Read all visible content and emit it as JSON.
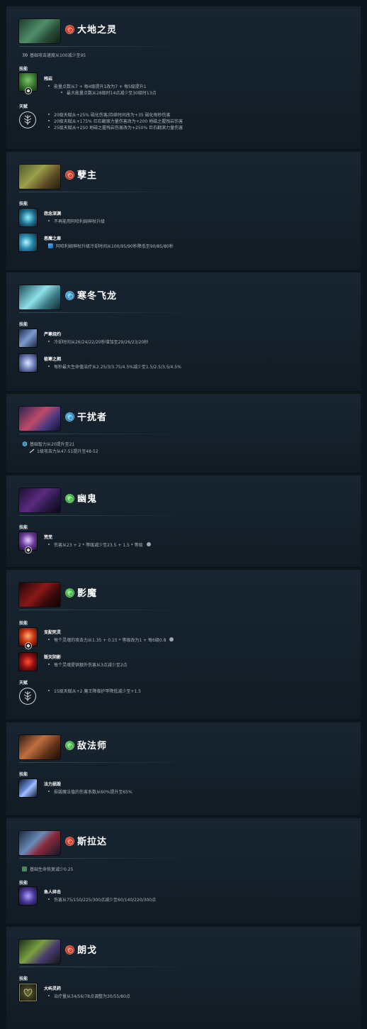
{
  "labels": {
    "abilities": "技能",
    "talents": "天赋"
  },
  "heroes": [
    {
      "name": "大地之灵",
      "attribute": "strength",
      "general": [
        "基础攻击速度从100减少至95"
      ],
      "abilities": [
        {
          "name": "残岩",
          "notes": [
            "能量点数从7 + 每4级提升1改为7 + 每5级提升1",
            "最大能量点数从28级时14点减少至30级时13点"
          ]
        }
      ],
      "talents": [
        "20级天赋从+25% 磁化伤害/持续时间改为+35 磁化每秒伤害",
        "20级天赋从+175% 巨石翻滚力量伤害改为+200 地磁之握残岩伤害",
        "25级天赋从+250 地磁之握残岩伤害改为+250% 巨石翻滚力量伤害"
      ]
    },
    {
      "name": "孽主",
      "attribute": "strength",
      "abilities": [
        {
          "name": "怨念深渊",
          "notes": [
            "不再能用阿哈利姆神杖升级"
          ]
        },
        {
          "name": "恶魔之扉",
          "notes": [
            "阿哈利姆神杖升级冷却时间从100/95/90秒降低至90/85/80秒"
          ]
        }
      ]
    },
    {
      "name": "寒冬飞龙",
      "attribute": "intelligence",
      "abilities": [
        {
          "name": "严寒烧灼",
          "notes": [
            "冷却时间从26/24/22/20秒增加至29/26/23/20秒"
          ]
        },
        {
          "name": "极寒之拥",
          "notes": [
            "每秒最大生命值治疗从2.25/3/3.75/4.5%减少至1.5/2.5/3.5/4.5%"
          ]
        }
      ]
    },
    {
      "name": "干扰者",
      "attribute": "intelligence",
      "general": [
        "基础智力从20提升至21",
        "1级攻击力从47-51提升至48-52"
      ]
    },
    {
      "name": "幽鬼",
      "attribute": "agility",
      "abilities": [
        {
          "name": "荒芜",
          "notes": [
            "伤害从23 + 2 * 等级减少至23.5 + 1.5 * 等级"
          ]
        }
      ]
    },
    {
      "name": "影魔",
      "attribute": "agility",
      "abilities": [
        {
          "name": "支配死灵",
          "notes": [
            "每个灵魂的攻击力从1.35 + 0.15 * 等级改为1 + 每6级0.8"
          ]
        },
        {
          "name": "毁灭阴影",
          "notes": [
            "每个灵魂提供额外伤害从3点减少至2点"
          ]
        }
      ],
      "talents": [
        "15级天赋从+2 魔王降临护甲降低减少至+1.5"
      ]
    },
    {
      "name": "敌法师",
      "attribute": "agility",
      "abilities": [
        {
          "name": "法力损毁",
          "notes": [
            "损毁魔法值的伤害系数从60%提升至65%"
          ]
        }
      ]
    },
    {
      "name": "斯拉达",
      "attribute": "strength",
      "general": [
        "基础生命恢复减少0.25"
      ],
      "abilities": [
        {
          "name": "鱼人碎击",
          "notes": [
            "伤害从75/150/225/300点减少至60/140/220/300点"
          ]
        }
      ]
    },
    {
      "name": "朗戈",
      "attribute": "strength",
      "abilities": [
        {
          "name": "大屿灵药",
          "notes": [
            "治疗量从34/56/78点调整为30/55/80点"
          ]
        }
      ]
    }
  ]
}
